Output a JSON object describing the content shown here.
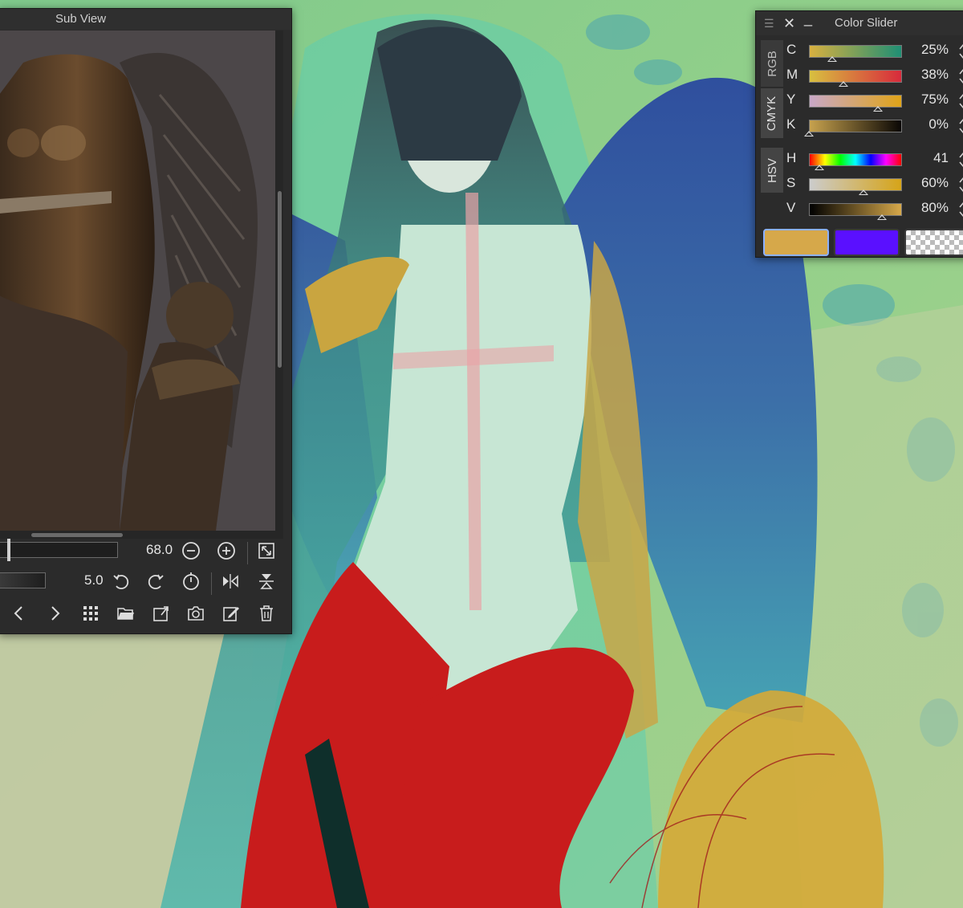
{
  "sub_view": {
    "title": "Sub View",
    "zoom_value": "68.0",
    "rotate_value": "5.0",
    "icons": {
      "zoom_out": "zoom-out-icon",
      "zoom_in": "zoom-in-icon",
      "fit": "fit-window-icon",
      "rotate_left": "rotate-left-icon",
      "rotate_right": "rotate-right-icon",
      "reset_rotate": "reset-rotation-icon",
      "flip_h": "flip-horizontal-icon",
      "flip_v": "flip-vertical-icon",
      "prev": "previous-image-icon",
      "next": "next-image-icon",
      "grid": "thumbnail-grid-icon",
      "open": "open-folder-icon",
      "import": "import-image-icon",
      "camera": "capture-canvas-icon",
      "edit": "edit-icon",
      "delete": "delete-icon"
    }
  },
  "color_slider": {
    "title": "Color Slider",
    "tabs": [
      "RGB",
      "CMYK",
      "HSV"
    ],
    "active_tabs": [
      "CMYK",
      "HSV"
    ],
    "cmyk": [
      {
        "label": "C",
        "value": "25%",
        "fraction": 0.25
      },
      {
        "label": "M",
        "value": "38%",
        "fraction": 0.38
      },
      {
        "label": "Y",
        "value": "75%",
        "fraction": 0.75
      },
      {
        "label": "K",
        "value": "0%",
        "fraction": 0.0
      }
    ],
    "hsv": [
      {
        "label": "H",
        "value": "41",
        "fraction": 0.11
      },
      {
        "label": "S",
        "value": "60%",
        "fraction": 0.6
      },
      {
        "label": "V",
        "value": "80%",
        "fraction": 0.8
      }
    ],
    "main_color": "#d6a84a",
    "sub_color": "#5a10ff",
    "transparent_swatch": "transparent-swatch"
  }
}
